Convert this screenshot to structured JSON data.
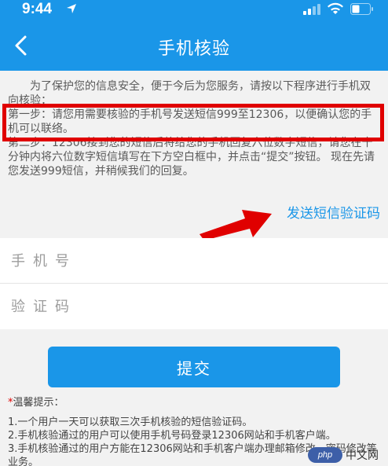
{
  "status_bar": {
    "time": "9:44"
  },
  "nav": {
    "title": "手机核验"
  },
  "instructions": {
    "intro": "为了保护您的信息安全，便于今后为您服务，请按以下程序进行手机双向核验：",
    "step1": "第一步：请您用需要核验的手机号发送短信999至12306，以便确认您的手机可以联络。",
    "step2": "第二步：12306接到您的短信后将给您的手机回复六位数字短信，请您在十分钟内将六位数字短信填写在下方空白框中，并点击“提交”按钮。 现在先请您发送999短信，并稍候我们的回复。"
  },
  "send_code_label": "发送短信验证码",
  "form": {
    "phone_placeholder": "手机号",
    "code_placeholder": "验证码",
    "submit_label": "提交"
  },
  "tips": {
    "star": "*",
    "title": "温馨提示：",
    "items": [
      "1.一个用户一天可以获取三次手机核验的短信验证码。",
      "2.手机核验通过的用户可以使用手机号码登录12306网站和手机客户端。",
      "3.手机核验通过的用户方能在12306网站和手机客户端办理邮箱修改、密码修改等业务。"
    ]
  },
  "watermark": {
    "badge": "php",
    "text": "中文网"
  },
  "colors": {
    "accent": "#1a96e8",
    "highlight": "#e00000"
  }
}
